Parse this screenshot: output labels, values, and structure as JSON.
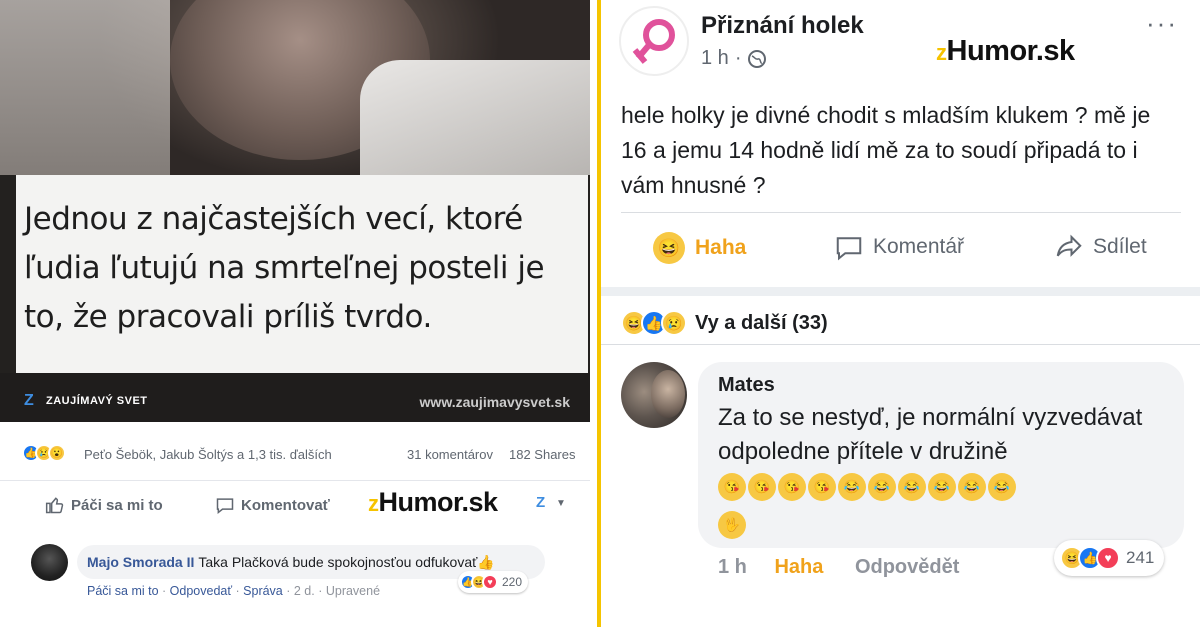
{
  "left": {
    "quote": "Jednou z najčastejších vecí, ktoré ľudia ľutujú na smrteľnej posteli je to, že pracovali príliš tvrdo.",
    "brand": {
      "logo": "Z",
      "name": "ZAUJÍMAVÝ SVET",
      "url": "www.zaujimavysvet.sk"
    },
    "stats": {
      "names": "Peťo Šebök, Jakub Šoltýs a 1,3 tis. ďalších",
      "comments": "31 komentárov",
      "shares": "182 Shares"
    },
    "actions": {
      "like": "Páči sa mi to",
      "comment": "Komentovať",
      "share_logo": "Z"
    },
    "watermark": "Humor.sk",
    "comment": {
      "author": "Majo Smorada II",
      "text": "Taka Plačková bude spokojnosťou odfukovať👍",
      "like": "Páči sa mi to",
      "reply": "Odpovedať",
      "message": "Správa",
      "time": "2 d.",
      "edited": "Upravené",
      "reaction_count": "220"
    }
  },
  "right": {
    "group_name": "Přiznání holek",
    "time": "1 h",
    "watermark": "Humor.sk",
    "post_text": "hele holky je divné chodit s mladším klukem ? mě je 16 a jemu 14 hodně lidí mě za to soudí připadá to i vám hnusné ?",
    "actions": {
      "haha": "Haha",
      "comment": "Komentář",
      "share": "Sdílet"
    },
    "reactions_label": "Vy a další (33)",
    "comment": {
      "author": "Mates",
      "text": "Za to se nestyď, je normální vyzvedávat odpoledne přítele v družině",
      "time": "1 h",
      "haha": "Haha",
      "reply": "Odpovědět",
      "reaction_count": "241"
    }
  },
  "colors": {
    "divider": "#f5c400",
    "fb_blue": "#385898",
    "haha_orange": "#f0a21b"
  }
}
